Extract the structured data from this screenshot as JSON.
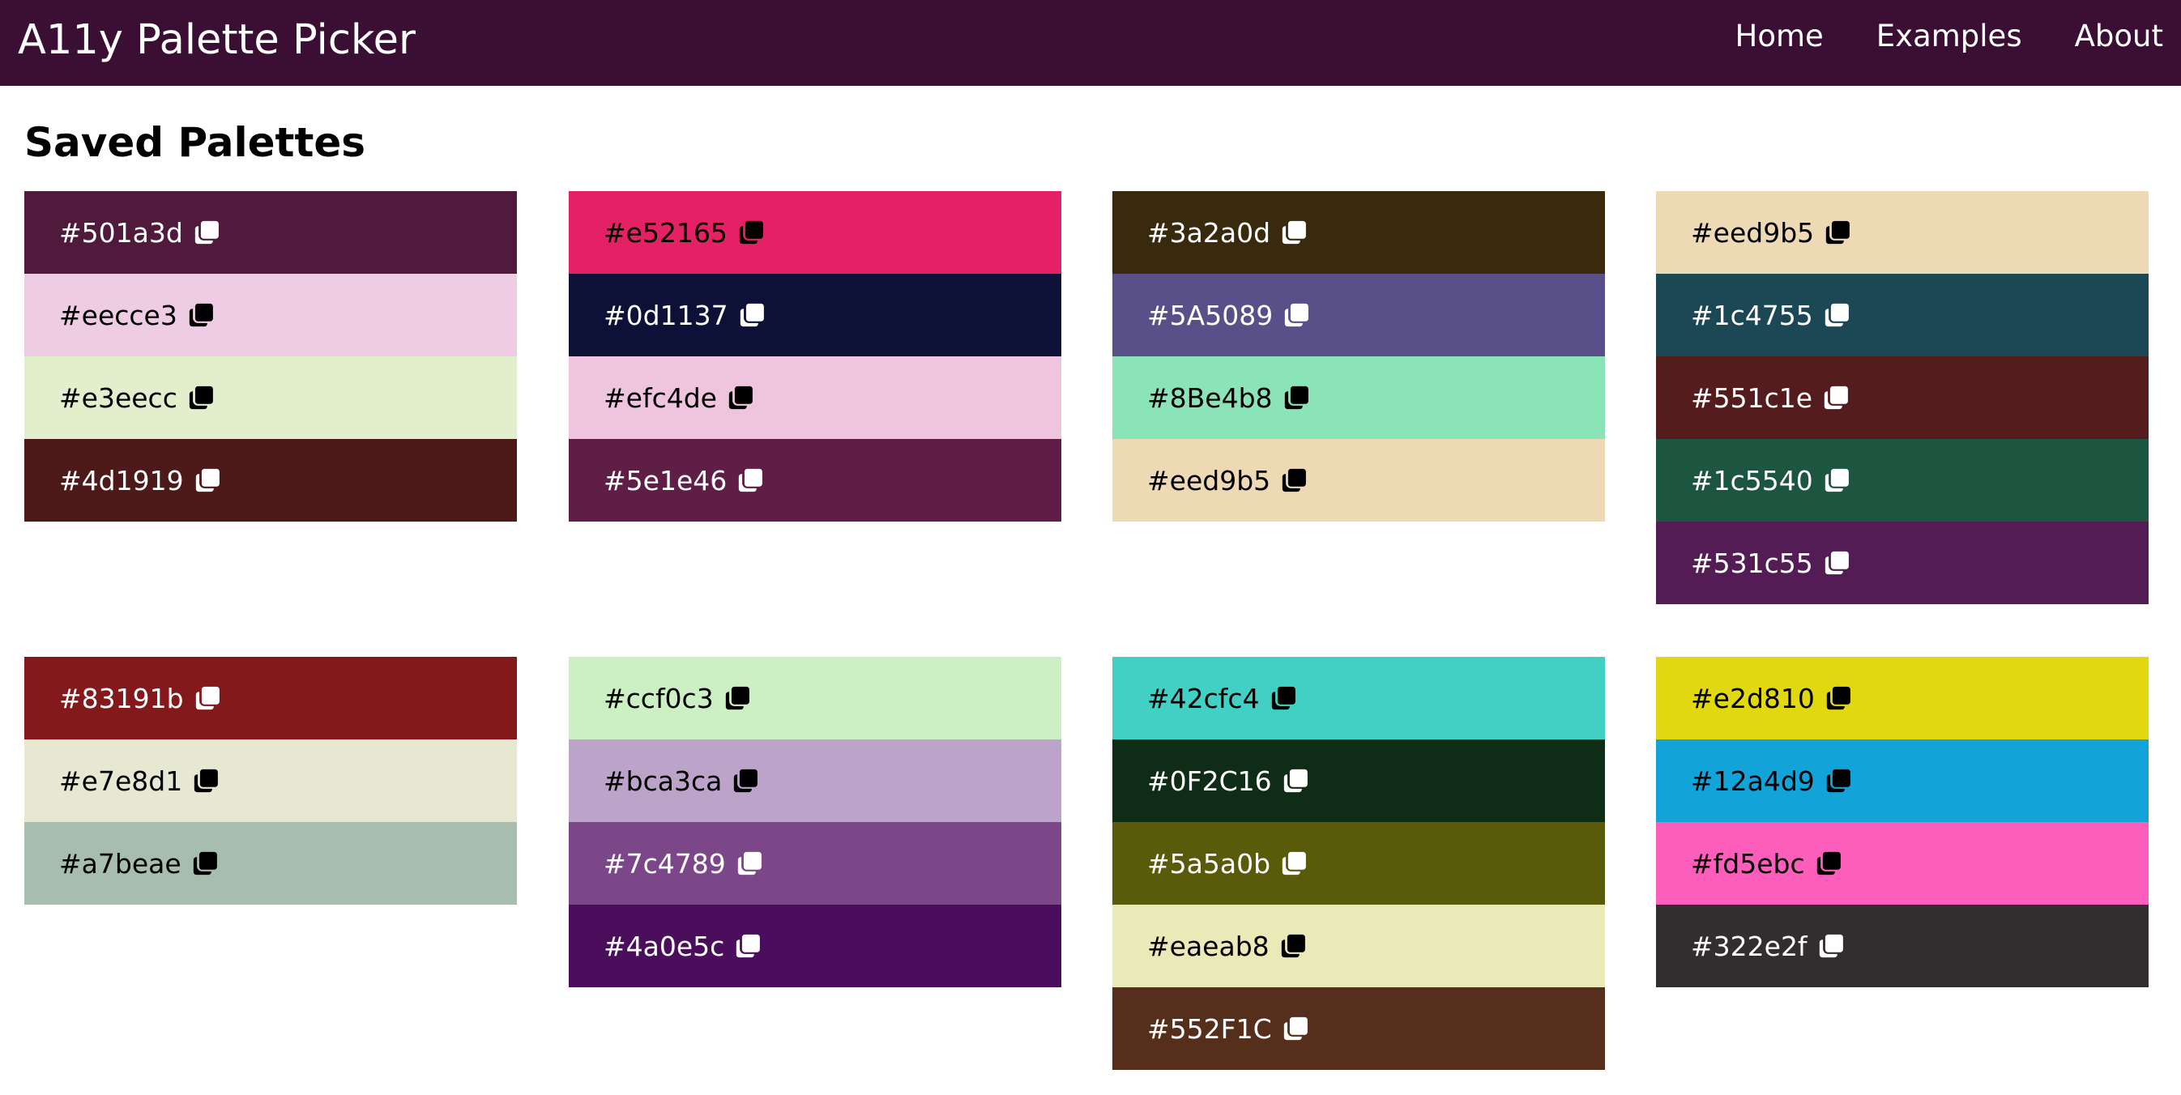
{
  "navbar": {
    "brand": "A11y Palette Picker",
    "links": [
      "Home",
      "Examples",
      "About"
    ]
  },
  "page_title": "Saved Palettes",
  "palettes": [
    {
      "swatches": [
        {
          "hex": "#501a3d",
          "bg": "#501a3d",
          "fg": "#ffffff"
        },
        {
          "hex": "#eecce3",
          "bg": "#eecce3",
          "fg": "#000000"
        },
        {
          "hex": "#e3eecc",
          "bg": "#e3eecc",
          "fg": "#000000"
        },
        {
          "hex": "#4d1919",
          "bg": "#4d1919",
          "fg": "#ffffff"
        }
      ]
    },
    {
      "swatches": [
        {
          "hex": "#e52165",
          "bg": "#e52165",
          "fg": "#000000"
        },
        {
          "hex": "#0d1137",
          "bg": "#0d1137",
          "fg": "#ffffff"
        },
        {
          "hex": "#efc4de",
          "bg": "#efc4de",
          "fg": "#000000"
        },
        {
          "hex": "#5e1e46",
          "bg": "#5e1e46",
          "fg": "#ffffff"
        }
      ]
    },
    {
      "swatches": [
        {
          "hex": "#3a2a0d",
          "bg": "#3a2a0d",
          "fg": "#ffffff"
        },
        {
          "hex": "#5A5089",
          "bg": "#5a5089",
          "fg": "#ffffff"
        },
        {
          "hex": "#8Be4b8",
          "bg": "#8be4b8",
          "fg": "#000000"
        },
        {
          "hex": "#eed9b5",
          "bg": "#eed9b5",
          "fg": "#000000"
        }
      ]
    },
    {
      "swatches": [
        {
          "hex": "#eed9b5",
          "bg": "#eed9b5",
          "fg": "#000000"
        },
        {
          "hex": "#1c4755",
          "bg": "#1c4755",
          "fg": "#ffffff"
        },
        {
          "hex": "#551c1e",
          "bg": "#551c1e",
          "fg": "#ffffff"
        },
        {
          "hex": "#1c5540",
          "bg": "#1c5540",
          "fg": "#ffffff"
        },
        {
          "hex": "#531c55",
          "bg": "#531c55",
          "fg": "#ffffff"
        }
      ]
    },
    {
      "swatches": [
        {
          "hex": "#83191b",
          "bg": "#83191b",
          "fg": "#ffffff"
        },
        {
          "hex": "#e7e8d1",
          "bg": "#e7e8d1",
          "fg": "#000000"
        },
        {
          "hex": "#a7beae",
          "bg": "#a7beae",
          "fg": "#000000"
        }
      ]
    },
    {
      "swatches": [
        {
          "hex": "#ccf0c3",
          "bg": "#ccf0c3",
          "fg": "#000000"
        },
        {
          "hex": "#bca3ca",
          "bg": "#bca3ca",
          "fg": "#000000"
        },
        {
          "hex": "#7c4789",
          "bg": "#7c4789",
          "fg": "#ffffff"
        },
        {
          "hex": "#4a0e5c",
          "bg": "#4a0e5c",
          "fg": "#ffffff"
        }
      ]
    },
    {
      "swatches": [
        {
          "hex": "#42cfc4",
          "bg": "#42cfc4",
          "fg": "#000000"
        },
        {
          "hex": "#0F2C16",
          "bg": "#0f2c16",
          "fg": "#ffffff"
        },
        {
          "hex": "#5a5a0b",
          "bg": "#5a5a0b",
          "fg": "#ffffff"
        },
        {
          "hex": "#eaeab8",
          "bg": "#eaeab8",
          "fg": "#000000"
        },
        {
          "hex": "#552F1C",
          "bg": "#552f1c",
          "fg": "#ffffff"
        }
      ]
    },
    {
      "swatches": [
        {
          "hex": "#e2d810",
          "bg": "#e2d810",
          "fg": "#000000"
        },
        {
          "hex": "#12a4d9",
          "bg": "#12a4d9",
          "fg": "#000000"
        },
        {
          "hex": "#fd5ebc",
          "bg": "#fd5ebc",
          "fg": "#000000"
        },
        {
          "hex": "#322e2f",
          "bg": "#322e2f",
          "fg": "#ffffff"
        }
      ]
    }
  ]
}
